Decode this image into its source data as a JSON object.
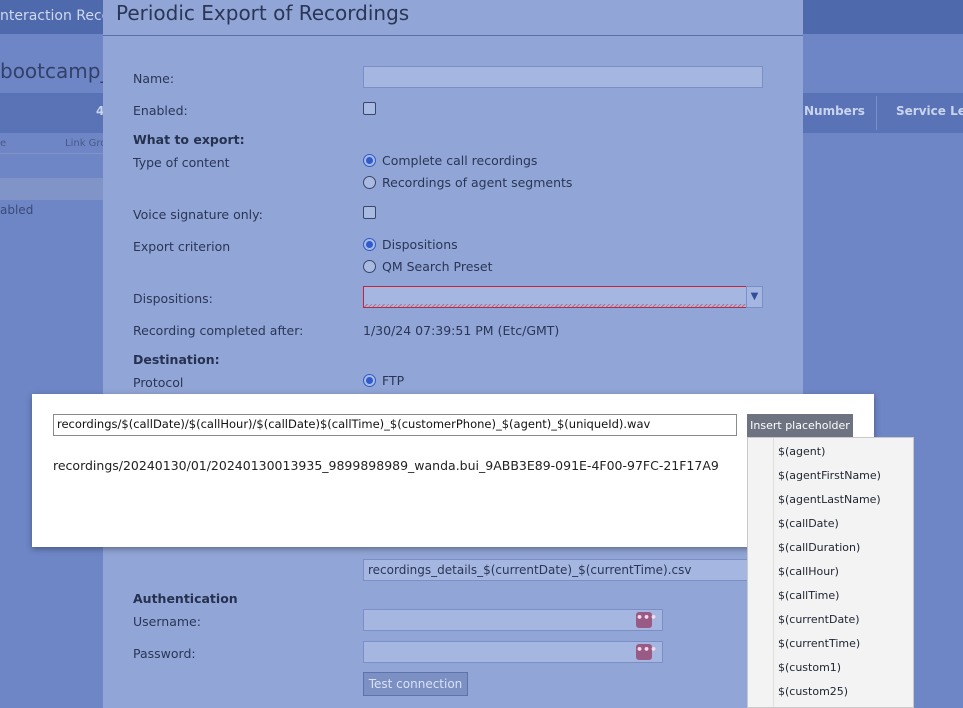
{
  "background": {
    "app_title": "nteraction Recor",
    "page_name": "bootcamp_e",
    "tab_partial": "4",
    "tabs": [
      "Numbers",
      "Service Leve"
    ],
    "columns": [
      "e",
      "Link Gro"
    ],
    "row_status": "abled"
  },
  "dialog": {
    "title": "Periodic Export of Recordings",
    "labels": {
      "name": "Name:",
      "enabled": "Enabled:",
      "what_to_export": "What to export:",
      "type_of_content": "Type of content",
      "voice_signature_only": "Voice signature only:",
      "export_criterion": "Export criterion",
      "dispositions": "Dispositions:",
      "recording_completed_after": "Recording completed after:",
      "destination": "Destination:",
      "protocol": "Protocol",
      "authentication": "Authentication",
      "username": "Username:",
      "password": "Password:"
    },
    "content_options": [
      "Complete call recordings",
      "Recordings of agent segments"
    ],
    "criterion_options": [
      "Dispositions",
      "QM Search Preset"
    ],
    "recording_completed_value": "1/30/24 07:39:51 PM (Etc/GMT)",
    "protocol_option": "FTP",
    "details_file_name": "recordings_details_$(currentDate)_$(currentTime).csv",
    "dots": "•••",
    "test_connection_label": "Test connection"
  },
  "placeholder_editor": {
    "pattern": "recordings/$(callDate)/$(callHour)/$(callDate)$(callTime)_$(customerPhone)_$(agent)_$(uniqueId).wav",
    "insert_label": "Insert placeholder",
    "preview": "recordings/20240130/01/20240130013935_9899898989_wanda.bui_9ABB3E89-091E-4F00-97FC-21F17A9",
    "placeholders": [
      "$(agent)",
      "$(agentFirstName)",
      "$(agentLastName)",
      "$(callDate)",
      "$(callDuration)",
      "$(callHour)",
      "$(callTime)",
      "$(currentDate)",
      "$(currentTime)",
      "$(custom1)",
      "$(custom25)"
    ]
  }
}
